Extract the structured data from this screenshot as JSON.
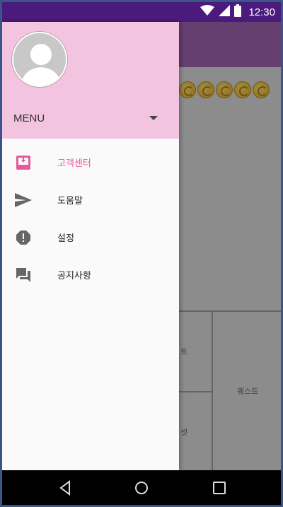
{
  "status_bar": {
    "time": "12:30",
    "colors": {
      "background": "#4a1a7c"
    },
    "icons": [
      "wifi-icon",
      "signal-icon",
      "battery-icon"
    ]
  },
  "drawer": {
    "header": {
      "menu_label": "MENU",
      "background": "#f3c4df"
    },
    "items": [
      {
        "label": "고객센터",
        "icon": "inbox-icon",
        "active": true
      },
      {
        "label": "도움말",
        "icon": "send-icon",
        "active": false
      },
      {
        "label": "설정",
        "icon": "alert-icon",
        "active": false
      },
      {
        "label": "공지사항",
        "icon": "forum-icon",
        "active": false
      }
    ],
    "accent": "#e45a9b"
  },
  "background_app": {
    "toolbar_color": "#9a62ad",
    "coin_count": 5,
    "grid_labels": [
      "트",
      "퀘스트",
      "셋"
    ]
  },
  "system_nav": {
    "buttons": [
      "back-icon",
      "home-icon",
      "recents-icon"
    ]
  }
}
